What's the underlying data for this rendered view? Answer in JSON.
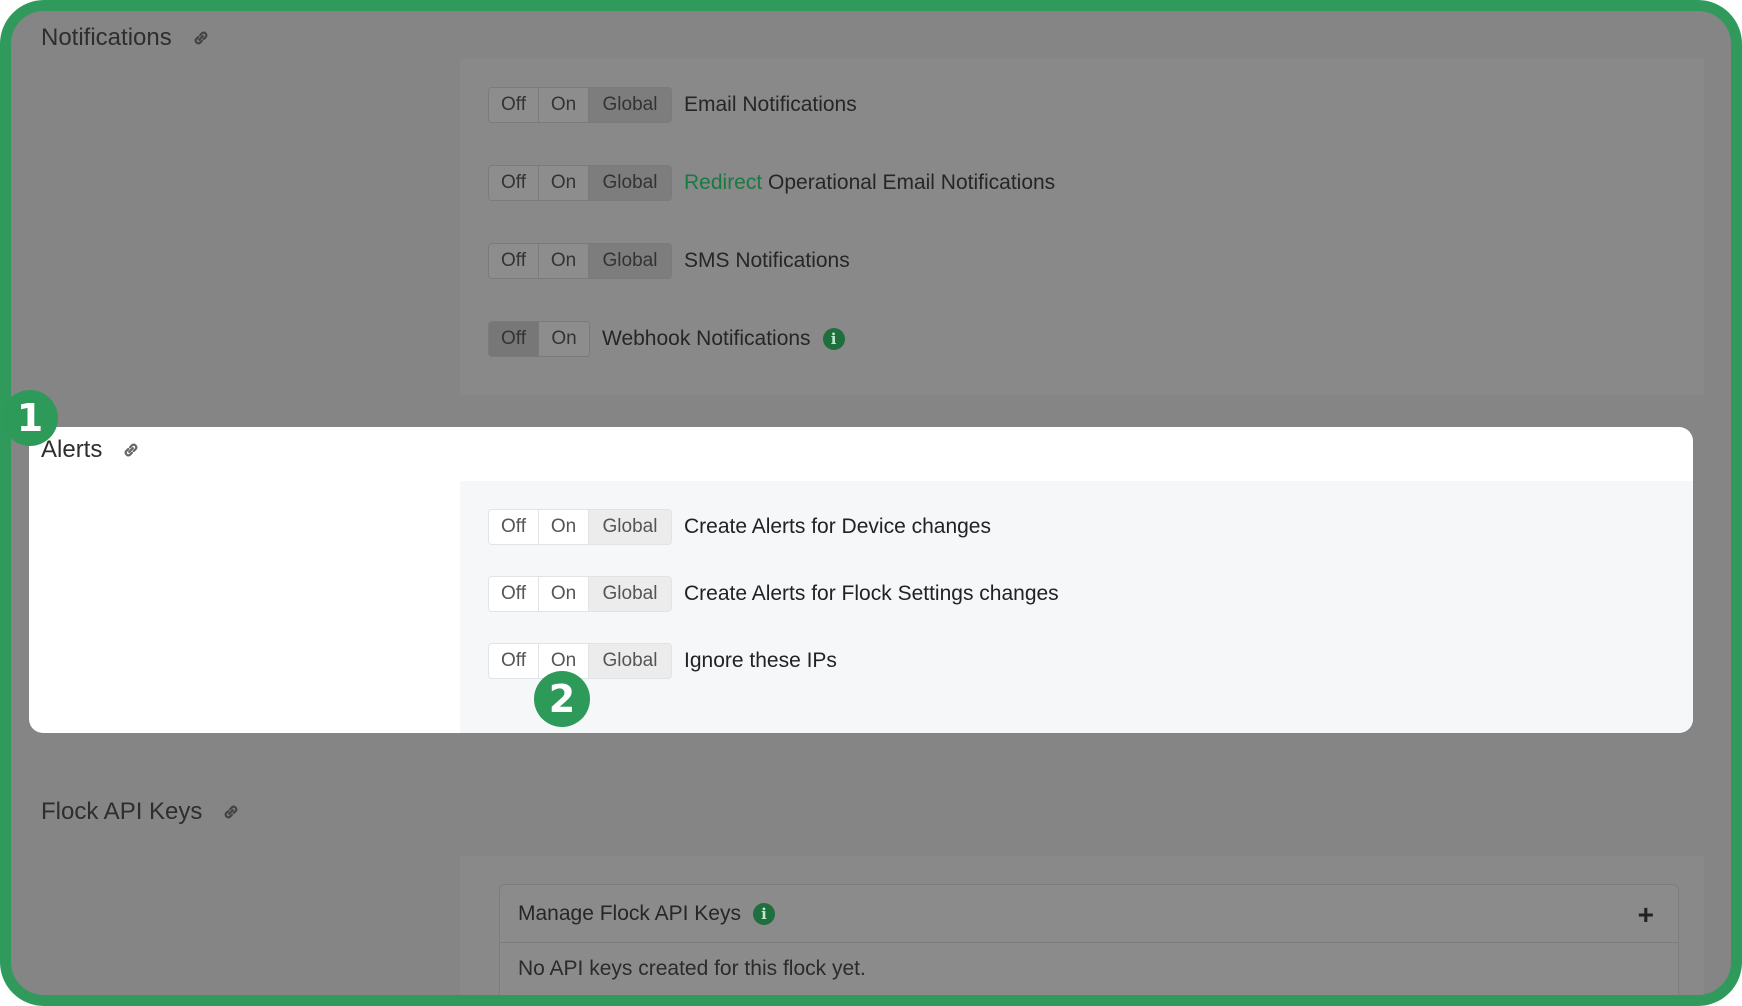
{
  "sections": {
    "notifications": {
      "title": "Notifications",
      "rows": [
        {
          "off": "Off",
          "on": "On",
          "global": "Global",
          "label": "Email Notifications"
        },
        {
          "off": "Off",
          "on": "On",
          "global": "Global",
          "label_link": "Redirect",
          "label": "Operational Email Notifications"
        },
        {
          "off": "Off",
          "on": "On",
          "global": "Global",
          "label": "SMS Notifications"
        },
        {
          "off": "Off",
          "on": "On",
          "label": "Webhook Notifications"
        }
      ]
    },
    "alerts": {
      "title": "Alerts",
      "rows": [
        {
          "off": "Off",
          "on": "On",
          "global": "Global",
          "label": "Create Alerts for Device changes"
        },
        {
          "off": "Off",
          "on": "On",
          "global": "Global",
          "label": "Create Alerts for Flock Settings changes"
        },
        {
          "off": "Off",
          "on": "On",
          "global": "Global",
          "label": "Ignore these IPs"
        }
      ]
    },
    "api_keys": {
      "title": "Flock API Keys",
      "card_title": "Manage Flock API Keys",
      "add_symbol": "+",
      "empty_text": "No API keys created for this flock yet."
    }
  },
  "badges": {
    "one": "1",
    "two": "2"
  },
  "colors": {
    "accent": "#2e9a59",
    "frame": "#2f9a5b",
    "link": "#1a7a42"
  },
  "icons": {
    "section_link": "link-icon",
    "info": "info-icon",
    "add": "plus-icon"
  }
}
